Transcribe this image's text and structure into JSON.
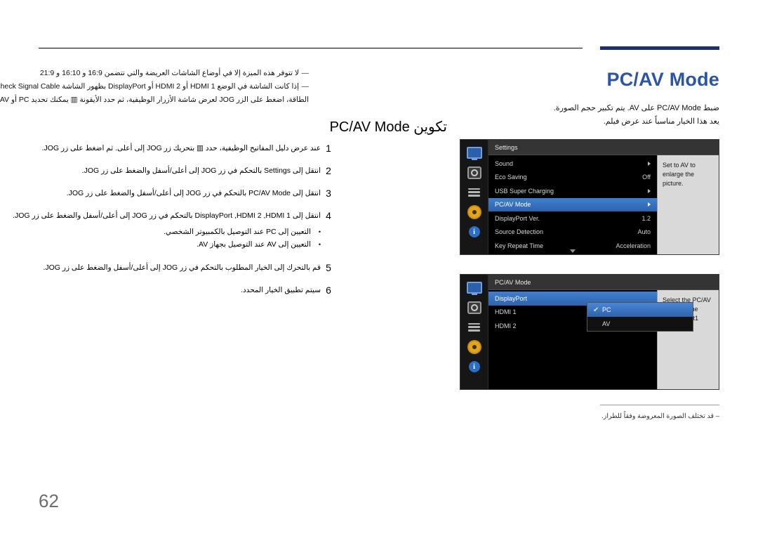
{
  "page": {
    "number": "62",
    "title": "PC/AV Mode",
    "intro_lines": [
      "ضبط PC/AV Mode على AV. يتم تكبير حجم الصورة.",
      "يعد هذا الخيار مناسباً عند عرض فيلم."
    ],
    "section_heading": "تكوين PC/AV Mode",
    "bottom_note": "قد تختلف الصورة المعروضة وفقاً للطراز."
  },
  "notes": [
    "لا تتوفر هذه الميزة إلا في أوضاع الشاشات العريضة والتي تتضمن 16:9 و 16:10 و 21:9",
    "إذا كانت الشاشة في الوضع HDMI 1 أو HDMI 2 أو DisplayPort بظهور الشاشة Check Signal Cable، أو في حالة تنشيط وضع توفير الطاقة، اضغط على الزر JOG لعرض شاشة الأزرار الوظيفية، ثم حدد الأيقونة ▥ يمكنك تحديد PC أو AV."
  ],
  "steps": [
    {
      "num": "1",
      "text": "عند عرض دليل المفاتيح الوظيفية، حدد ▥ بتحريك زر JOG إلى أعلى. ثم اضغط على زر JOG."
    },
    {
      "num": "2",
      "text": "انتقل إلى Settings بالتحكم في زر JOG إلى أعلى/أسفل والضغط على زر JOG."
    },
    {
      "num": "3",
      "text": "انتقل إلى PC/AV Mode بالتحكم في زر JOG إلى أعلى/أسفل والضغط على زر JOG."
    },
    {
      "num": "4",
      "text": "انتقل إلى DisplayPort ,HDMI 2 ,HDMI 1 بالتحكم في زر JOG إلى أعلى/أسفل والضغط على زر JOG.",
      "subitems": [
        "التعيين إلى PC عند التوصيل بالكمبيوتر الشخصي.",
        "التعيين إلى AV عند التوصيل بجهاز AV."
      ]
    },
    {
      "num": "5",
      "text": "قم بالتحرك إلى الخيار المطلوب بالتحكم في زر JOG إلى أعلى/أسفل والضغط على زر JOG."
    },
    {
      "num": "6",
      "text": "سيتم تطبيق الخيار المحدد."
    }
  ],
  "osd1": {
    "header": "Settings",
    "rows": [
      {
        "label": "Sound",
        "value": "",
        "arrow": true,
        "selected": false
      },
      {
        "label": "Eco Saving",
        "value": "Off",
        "arrow": false,
        "selected": false
      },
      {
        "label": "USB Super Charging",
        "value": "",
        "arrow": true,
        "selected": false
      },
      {
        "label": "PC/AV Mode",
        "value": "",
        "arrow": true,
        "selected": true
      },
      {
        "label": "DisplayPort Ver.",
        "value": "1.2",
        "arrow": false,
        "selected": false
      },
      {
        "label": "Source Detection",
        "value": "Auto",
        "arrow": false,
        "selected": false
      },
      {
        "label": "Key Repeat Time",
        "value": "Acceleration",
        "arrow": false,
        "selected": false
      }
    ],
    "help": "Set to AV to enlarge the picture."
  },
  "osd2": {
    "header": "PC/AV Mode",
    "rows": [
      {
        "label": "DisplayPort",
        "selected": true
      },
      {
        "label": "HDMI 1",
        "selected": false
      },
      {
        "label": "HDMI 2",
        "selected": false
      }
    ],
    "submenu": [
      {
        "label": "PC",
        "selected": true,
        "checked": true
      },
      {
        "label": "AV",
        "selected": false,
        "checked": false
      }
    ],
    "help": "Select the PC/AV mode for the DisplayPort1 source."
  },
  "icons": {
    "monitor": "monitor-icon",
    "brightness": "brightness-icon",
    "lines": "menu-lines-icon",
    "gear": "gear-icon",
    "info": "info-icon"
  }
}
